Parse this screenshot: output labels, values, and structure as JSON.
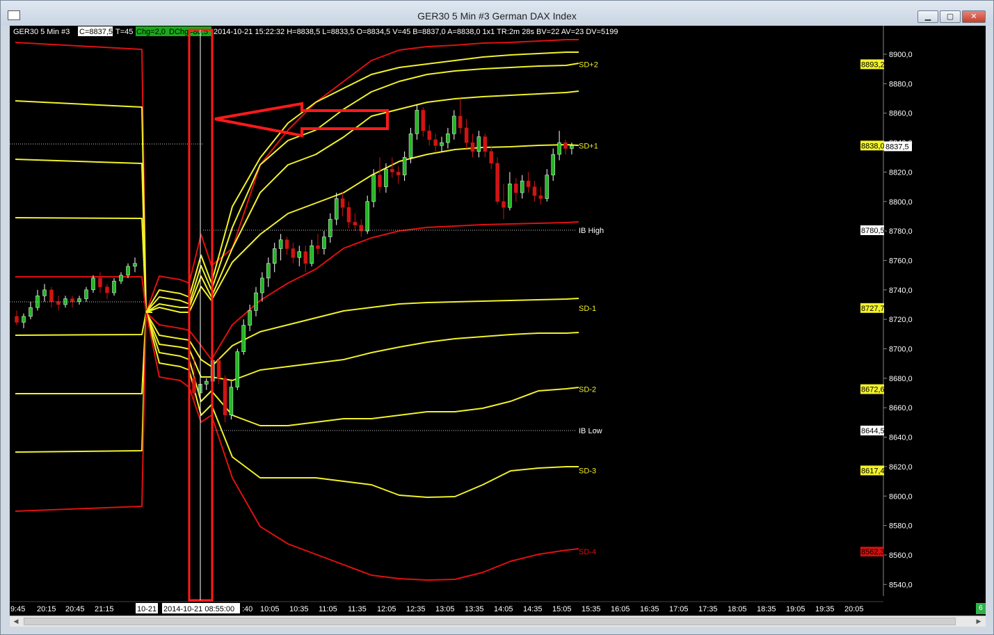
{
  "window": {
    "title": "GER30  5 Min   #3  German DAX Index",
    "minimize": "▁",
    "maximize": "▢",
    "close": "✕",
    "corner_badge": "6",
    "scroll_left": "◀",
    "scroll_right": "▶"
  },
  "header": {
    "symbol": "GER30  5 Min   #3",
    "close_box": "C=8837,5",
    "t_value": "T=45",
    "chg_box": "Chg=2,0",
    "dchg_box": "DChg=80,5",
    "details": "2014-10-21 15:22:32 H=8838,5 L=8833,5 O=8834,5 V=45 B=8837,0 A=8838,0 1x1 TR:2m 28s BV=22 AV=23 DV=5199"
  },
  "colors": {
    "background": "#000000",
    "red": "#e01010",
    "yellow": "#f2f22a",
    "up_candle": "#22b822",
    "down_candle": "#d01414",
    "annotation": "#ff1a1a"
  },
  "chart_data": {
    "type": "candlestick",
    "ylim": [
      8530,
      8910
    ],
    "y_ticks": [
      "8900,0",
      "8880,0",
      "8860,0",
      "8840,0",
      "8820,0",
      "8800,0",
      "8780,0",
      "8760,0",
      "8740,0",
      "8720,0",
      "8700,0",
      "8680,0",
      "8660,0",
      "8640,0",
      "8620,0",
      "8600,0",
      "8580,0",
      "8560,0",
      "8540,0"
    ],
    "x_ticks": [
      "9:45",
      "20:15",
      "20:45",
      "21:15",
      "10-21",
      "2014-10-21  08:55:00",
      ":40",
      "10:05",
      "10:35",
      "11:05",
      "11:35",
      "12:05",
      "12:35",
      "13:05",
      "13:35",
      "14:05",
      "14:35",
      "15:05",
      "15:35",
      "16:05",
      "16:35",
      "17:05",
      "17:35",
      "18:05",
      "18:35",
      "19:05",
      "19:35",
      "20:05"
    ],
    "band_labels": [
      {
        "name": "SD+2",
        "value": 8893.2,
        "price_label": "8893,2",
        "color": "yellow"
      },
      {
        "name": "SD+1",
        "value": 8838.0,
        "price_label": "8838,0",
        "color": "yellow"
      },
      {
        "name": "IB High",
        "value": 8780.5,
        "price_label": "8780,5",
        "color": "white"
      },
      {
        "name": "SD-1",
        "value": 8727.7,
        "price_label": "8727,7",
        "color": "yellow"
      },
      {
        "name": "SD-2",
        "value": 8672.6,
        "price_label": "8672,6",
        "color": "yellow"
      },
      {
        "name": "IB Low",
        "value": 8644.5,
        "price_label": "8644,5",
        "color": "white"
      },
      {
        "name": "SD-3",
        "value": 8617.4,
        "price_label": "8617,4",
        "color": "yellow"
      },
      {
        "name": "SD-4",
        "value": 8562.3,
        "price_label": "8562,3",
        "color": "red"
      }
    ],
    "last_price": {
      "value": 8837.5,
      "label": "8837,5"
    },
    "session_candles": [
      [
        8680,
        8694,
        8664,
        8670
      ],
      [
        8670,
        8682,
        8660,
        8676
      ],
      [
        8676,
        8680,
        8672,
        8678
      ],
      [
        8678,
        8696,
        8674,
        8692
      ],
      [
        8692,
        8694,
        8676,
        8680
      ],
      [
        8680,
        8682,
        8650,
        8655
      ],
      [
        8655,
        8678,
        8652,
        8674
      ],
      [
        8674,
        8700,
        8672,
        8698
      ],
      [
        8698,
        8720,
        8696,
        8716
      ],
      [
        8716,
        8730,
        8712,
        8726
      ],
      [
        8726,
        8742,
        8722,
        8738
      ],
      [
        8738,
        8752,
        8732,
        8748
      ],
      [
        8748,
        8762,
        8742,
        8758
      ],
      [
        8758,
        8772,
        8752,
        8768
      ],
      [
        8768,
        8778,
        8760,
        8774
      ],
      [
        8774,
        8776,
        8764,
        8768
      ],
      [
        8768,
        8772,
        8758,
        8762
      ],
      [
        8762,
        8770,
        8756,
        8766
      ],
      [
        8766,
        8770,
        8752,
        8758
      ],
      [
        8758,
        8774,
        8756,
        8770
      ],
      [
        8770,
        8778,
        8764,
        8768
      ],
      [
        8768,
        8780,
        8764,
        8776
      ],
      [
        8776,
        8792,
        8772,
        8788
      ],
      [
        8788,
        8806,
        8784,
        8802
      ],
      [
        8802,
        8806,
        8790,
        8796
      ],
      [
        8796,
        8800,
        8782,
        8786
      ],
      [
        8786,
        8792,
        8780,
        8784
      ],
      [
        8784,
        8788,
        8776,
        8780
      ],
      [
        8780,
        8804,
        8778,
        8800
      ],
      [
        8800,
        8822,
        8796,
        8818
      ],
      [
        8818,
        8830,
        8806,
        8810
      ],
      [
        8810,
        8826,
        8806,
        8822
      ],
      [
        8822,
        8830,
        8816,
        8820
      ],
      [
        8820,
        8824,
        8812,
        8818
      ],
      [
        8818,
        8834,
        8814,
        8830
      ],
      [
        8830,
        8850,
        8826,
        8846
      ],
      [
        8846,
        8866,
        8842,
        8862
      ],
      [
        8862,
        8864,
        8844,
        8848
      ],
      [
        8848,
        8852,
        8838,
        8842
      ],
      [
        8842,
        8846,
        8834,
        8838
      ],
      [
        8838,
        8844,
        8834,
        8840
      ],
      [
        8840,
        8850,
        8836,
        8846
      ],
      [
        8846,
        8862,
        8842,
        8858
      ],
      [
        8858,
        8870,
        8846,
        8850
      ],
      [
        8850,
        8856,
        8836,
        8840
      ],
      [
        8840,
        8846,
        8830,
        8834
      ],
      [
        8834,
        8848,
        8830,
        8844
      ],
      [
        8844,
        8846,
        8830,
        8834
      ],
      [
        8834,
        8838,
        8822,
        8826
      ],
      [
        8826,
        8830,
        8798,
        8800
      ],
      [
        8800,
        8812,
        8788,
        8796
      ],
      [
        8796,
        8820,
        8794,
        8812
      ],
      [
        8812,
        8816,
        8800,
        8806
      ],
      [
        8806,
        8818,
        8802,
        8814
      ],
      [
        8814,
        8820,
        8806,
        8810
      ],
      [
        8810,
        8814,
        8800,
        8804
      ],
      [
        8804,
        8810,
        8798,
        8802
      ],
      [
        8802,
        8822,
        8800,
        8818
      ],
      [
        8818,
        8836,
        8814,
        8832
      ],
      [
        8832,
        8848,
        8828,
        8840
      ],
      [
        8840,
        8842,
        8832,
        8836
      ],
      [
        8836,
        8840,
        8832,
        8838
      ]
    ],
    "prior_candles": [
      [
        8722,
        8726,
        8716,
        8718
      ],
      [
        8718,
        8724,
        8714,
        8722
      ],
      [
        8722,
        8732,
        8720,
        8728
      ],
      [
        8728,
        8740,
        8726,
        8736
      ],
      [
        8736,
        8744,
        8732,
        8740
      ],
      [
        8740,
        8742,
        8728,
        8732
      ],
      [
        8732,
        8736,
        8726,
        8730
      ],
      [
        8730,
        8736,
        8728,
        8734
      ],
      [
        8734,
        8736,
        8728,
        8732
      ],
      [
        8732,
        8736,
        8730,
        8734
      ],
      [
        8734,
        8742,
        8732,
        8740
      ],
      [
        8740,
        8750,
        8738,
        8748
      ],
      [
        8748,
        8752,
        8738,
        8742
      ],
      [
        8742,
        8744,
        8734,
        8738
      ],
      [
        8738,
        8748,
        8736,
        8746
      ],
      [
        8746,
        8752,
        8744,
        8750
      ],
      [
        8750,
        8758,
        8748,
        8756
      ],
      [
        8756,
        8762,
        8752,
        8758
      ]
    ]
  }
}
